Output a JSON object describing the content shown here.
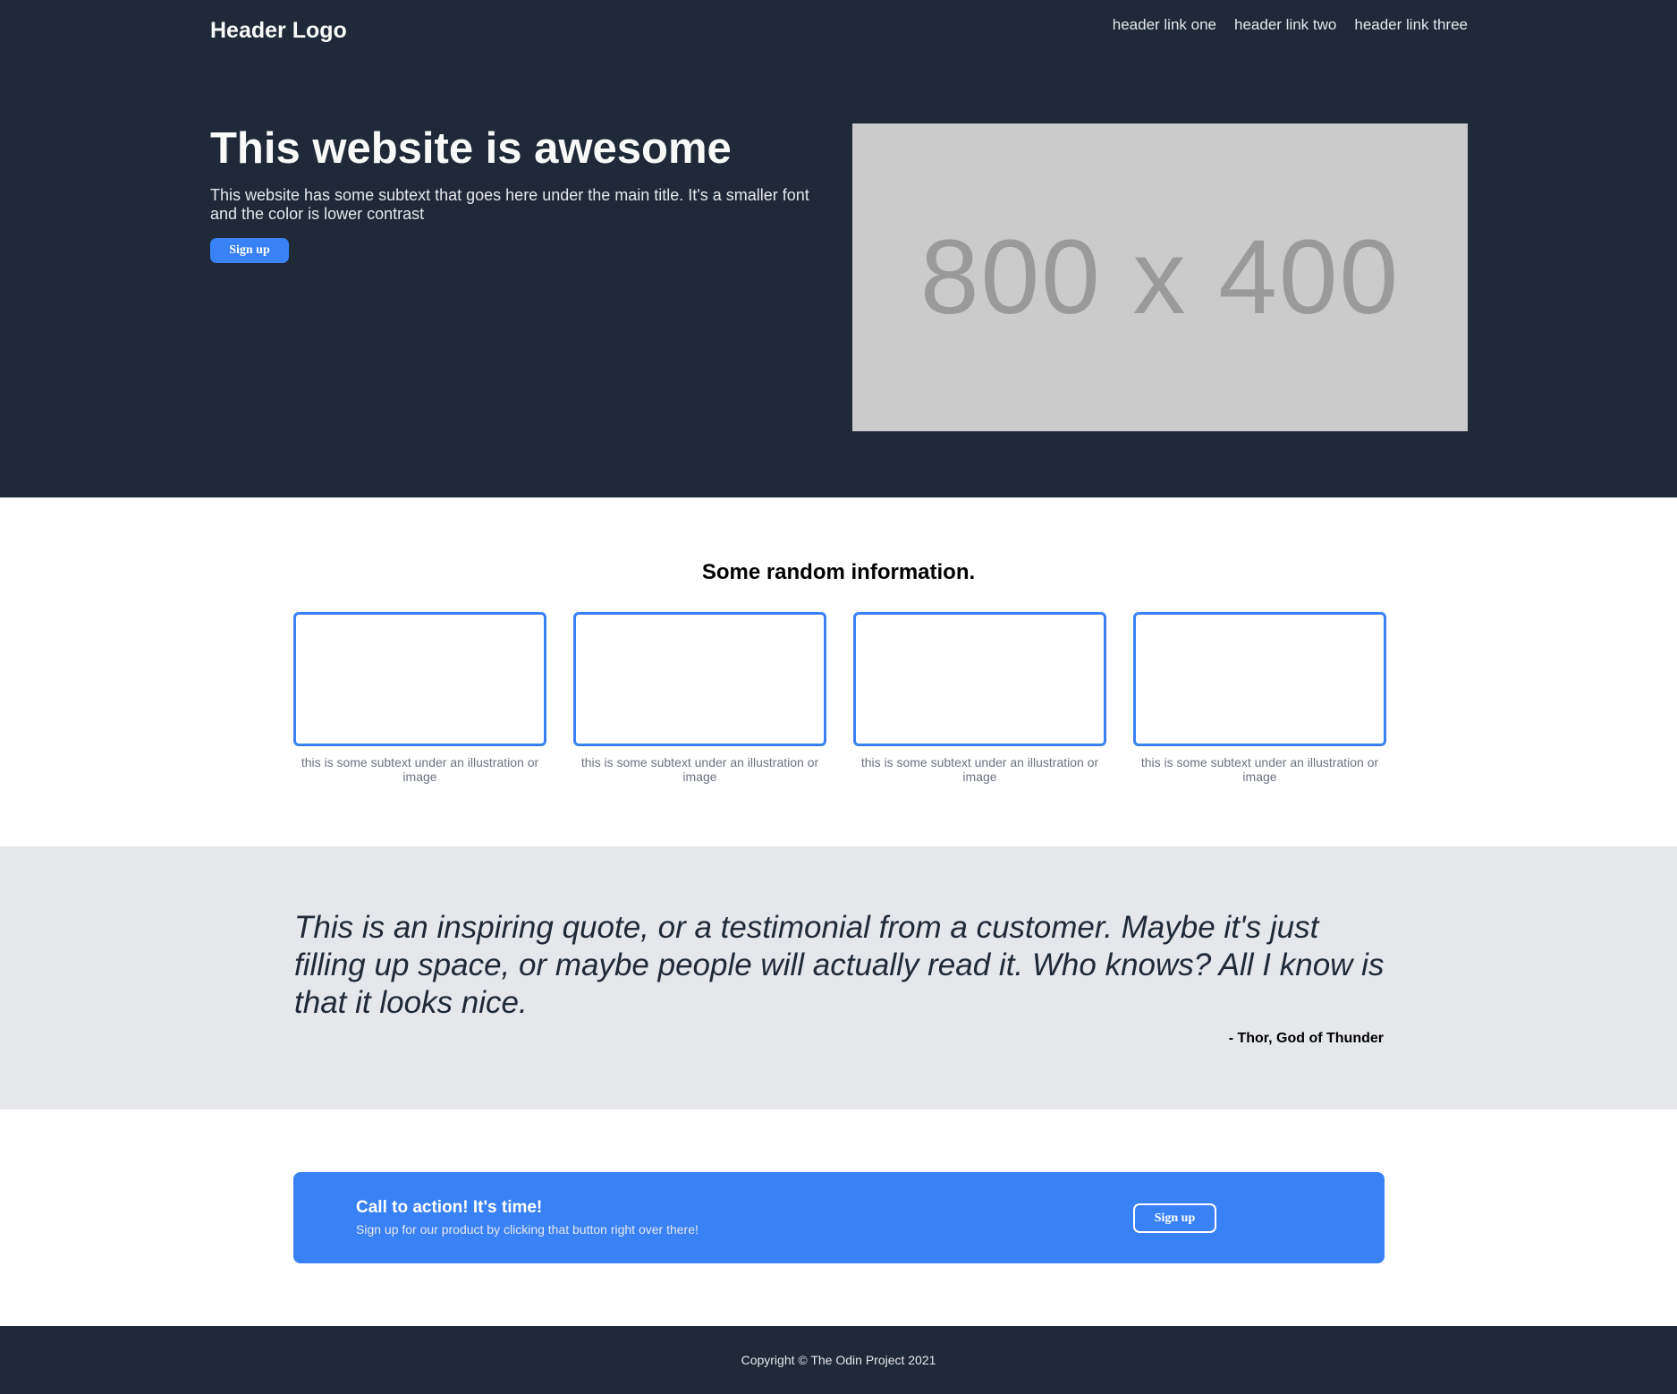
{
  "header": {
    "logo": "Header Logo",
    "nav": [
      "header link one",
      "header link two",
      "header link three"
    ]
  },
  "hero": {
    "title": "This website is awesome",
    "subtitle": "This website has some subtext that goes here under the main title. It's a smaller font and the color is lower contrast",
    "button_label": "Sign up",
    "image_placeholder": "800 x 400"
  },
  "info": {
    "title": "Some random information.",
    "cards": [
      {
        "caption": "this is some subtext under an illustration or image"
      },
      {
        "caption": "this is some subtext under an illustration or image"
      },
      {
        "caption": "this is some subtext under an illustration or image"
      },
      {
        "caption": "this is some subtext under an illustration or image"
      }
    ]
  },
  "quote": {
    "text": "This is an inspiring quote, or a testimonial from a customer. Maybe it's just filling up space, or maybe people will actually read it. Who knows? All I know is that it looks nice.",
    "author": "- Thor, God of Thunder"
  },
  "cta": {
    "title": "Call to action! It's time!",
    "subtitle": "Sign up for our product by clicking that button right over there!",
    "button_label": "Sign up"
  },
  "footer": {
    "copyright": "Copyright © The Odin Project 2021"
  },
  "colors": {
    "dark": "#1f2937",
    "accent": "#3882f6",
    "light_gray": "#e5e7eb",
    "muted_text": "#6b7280",
    "placeholder_bg": "#cbcbcb",
    "placeholder_text": "#9a9a9a"
  }
}
